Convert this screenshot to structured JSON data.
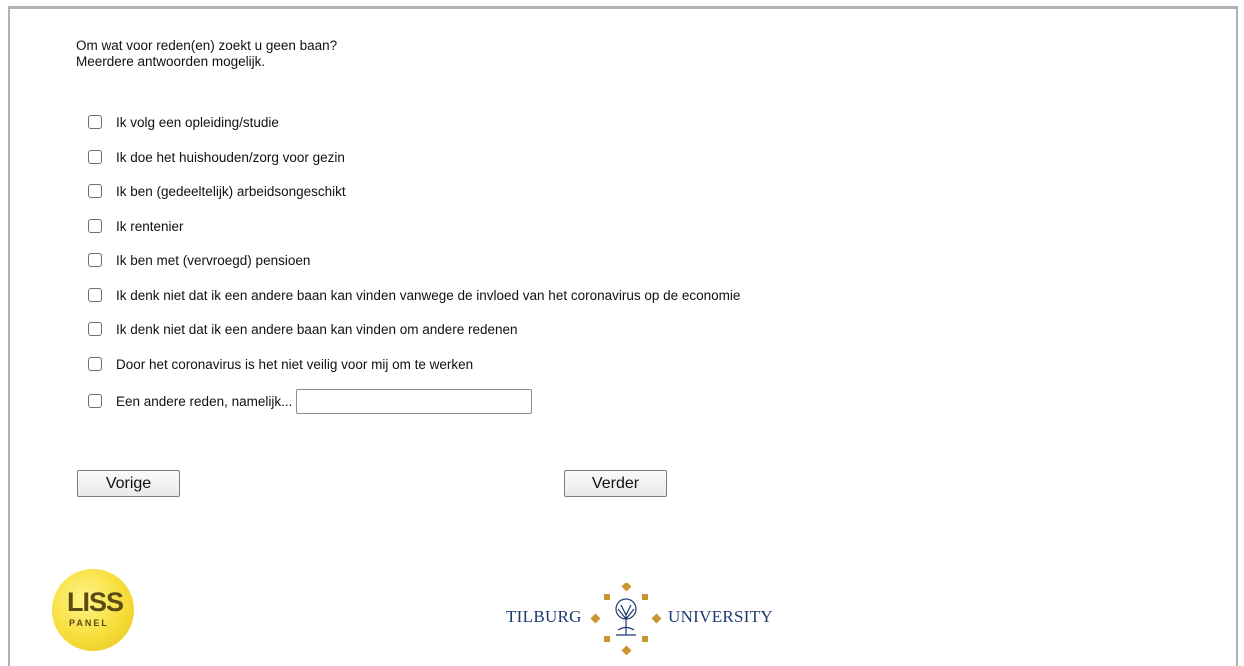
{
  "question": {
    "line1": "Om wat voor reden(en) zoekt u geen baan?",
    "line2": "Meerdere antwoorden mogelijk."
  },
  "options": [
    {
      "label": "Ik volg een opleiding/studie",
      "checked": false
    },
    {
      "label": "Ik doe het huishouden/zorg voor gezin",
      "checked": false
    },
    {
      "label": "Ik ben (gedeeltelijk) arbeidsongeschikt",
      "checked": false
    },
    {
      "label": "Ik rentenier",
      "checked": false
    },
    {
      "label": "Ik ben met (vervroegd) pensioen",
      "checked": false
    },
    {
      "label": "Ik denk niet dat ik een andere baan kan vinden vanwege de invloed van het coronavirus op de economie",
      "checked": false
    },
    {
      "label": "Ik denk niet dat ik een andere baan kan vinden om andere redenen",
      "checked": false
    },
    {
      "label": "Door het coronavirus is het niet veilig voor mij om te werken",
      "checked": false
    },
    {
      "label": "Een andere reden, namelijk...",
      "checked": false
    }
  ],
  "other_input": {
    "value": ""
  },
  "buttons": {
    "previous": "Vorige",
    "next": "Verder"
  },
  "logos": {
    "liss_main": "LISS",
    "liss_sub": "PANEL",
    "tilburg_left": "TILBURG",
    "tilburg_right": "UNIVERSITY"
  },
  "colors": {
    "liss_yellow": "#f7dd3a",
    "tilburg_blue": "#1c3a6e",
    "tilburg_gold": "#c9952f"
  }
}
